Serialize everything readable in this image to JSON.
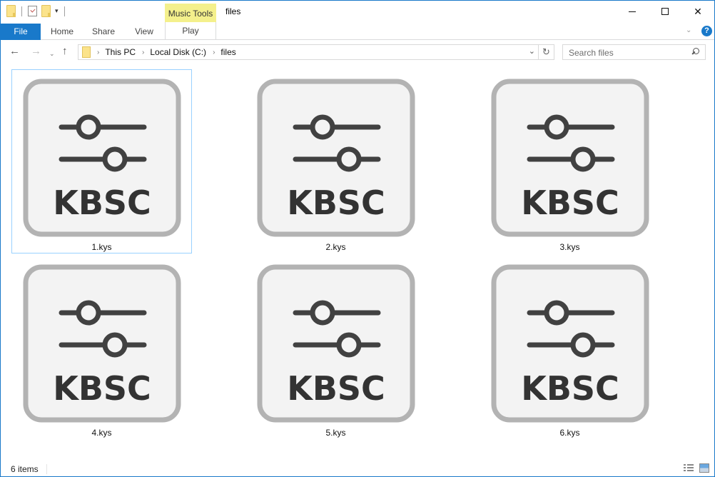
{
  "window": {
    "title": "files",
    "contextual_tab_group": "Music Tools",
    "controls": {
      "minimize": "minimize",
      "maximize": "maximize",
      "close": "✕"
    }
  },
  "quick_access": {
    "icons": [
      "properties-folder-icon",
      "checkmark-icon",
      "new-folder-icon",
      "customize-dropdown-icon"
    ],
    "dropdown_glyph": "▾"
  },
  "ribbon": {
    "tabs": [
      {
        "label": "File",
        "active": true
      },
      {
        "label": "Home"
      },
      {
        "label": "Share"
      },
      {
        "label": "View"
      },
      {
        "label": "Play"
      }
    ],
    "expand_glyph": "⌄",
    "help_glyph": "?"
  },
  "navigation": {
    "back_glyph": "←",
    "forward_glyph": "→",
    "recent_glyph": "⌄",
    "up_glyph": "↑",
    "breadcrumb": [
      "This PC",
      "Local Disk (C:)",
      "files"
    ],
    "crumb_separator": "›",
    "dropdown_glyph": "⌄",
    "refresh_glyph": "↻",
    "search_placeholder": "Search files"
  },
  "files": [
    {
      "name": "1.kys",
      "icon_text": "KBSC",
      "selected": true
    },
    {
      "name": "2.kys",
      "icon_text": "KBSC"
    },
    {
      "name": "3.kys",
      "icon_text": "KBSC"
    },
    {
      "name": "4.kys",
      "icon_text": "KBSC"
    },
    {
      "name": "5.kys",
      "icon_text": "KBSC"
    },
    {
      "name": "6.kys",
      "icon_text": "KBSC"
    }
  ],
  "status": {
    "item_count": "6 items"
  },
  "colors": {
    "accent": "#1979ca",
    "music_tools": "#f4f08c",
    "selection_border": "#99d1ff",
    "icon_frame": "#b3b3b3",
    "icon_fill": "#f3f3f3",
    "icon_glyph": "#414141"
  }
}
